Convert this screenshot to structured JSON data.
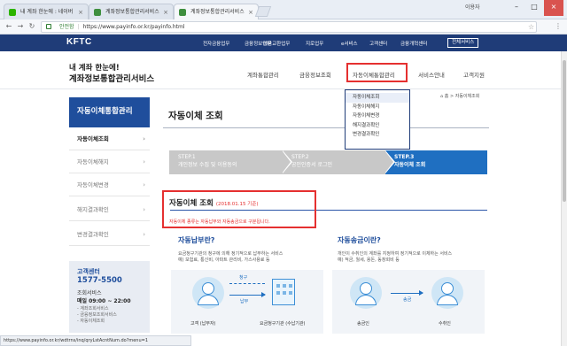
{
  "browser": {
    "tabs": [
      {
        "label": "내 계좌 한눈에 : 네이버"
      },
      {
        "label": "계좌정보통합관리서비스"
      },
      {
        "label": "계좌정보통합관리서비스"
      }
    ],
    "user": "이용자",
    "secure_label": "안전함",
    "url": "https://www.payinfo.or.kr/payinfo.html",
    "status_url": "https://www.payinfo.or.kr/wdtrns/inq/qryLstAcntNum.do?menu=1"
  },
  "gnb": {
    "logo": "KFTC",
    "items": [
      "전자금융업무",
      "금융정보업무",
      "어음교환업무",
      "지로업무",
      "e서비스",
      "고객센터",
      "금융개혁센터"
    ],
    "all_services": "전체서비스"
  },
  "header": {
    "brand_top": "내 계좌 한눈에!",
    "brand_main": "계좌정보통합관리서비스",
    "nav": [
      "계좌통합관리",
      "금융정보조회",
      "자동이체통합관리",
      "서비스안내",
      "고객지원"
    ]
  },
  "dropdown": {
    "items": [
      "자동이체조회",
      "자동이체해지",
      "자동이체변경",
      "해지결과확인",
      "변경결과확인"
    ]
  },
  "sidebar": {
    "title": "자동이체통합관리",
    "items": [
      "자동이체조회",
      "자동이체해지",
      "자동이체변경",
      "해지결과확인",
      "변경결과확인"
    ],
    "help": {
      "title": "고객센터",
      "phone": "1577-5500",
      "service": "조회서비스",
      "hours": "매일 09:00 ~ 22:00",
      "lines": [
        "- 계좌조회서비스",
        "- 금융정보조회서비스",
        "- 자동이체조회"
      ]
    }
  },
  "main": {
    "breadcrumb": "홈 > 자동이체조회",
    "title": "자동이체 조회",
    "steps": [
      {
        "num": "STEP.1",
        "label": "개인정보 수집 및 이용동의"
      },
      {
        "num": "STEP.2",
        "label": "공인인증서 로그인"
      },
      {
        "num": "STEP.3",
        "label": "자동이체 조회"
      }
    ],
    "notice": {
      "title": "자동이체 조회",
      "date": "(2018.01.15 기준)",
      "desc": "자동이체 종류는 자동납부와 자동송금으로 구분됩니다."
    },
    "payment": {
      "heading": "자동납부란?",
      "desc": "요금청구기관의 청구에 의해 정기적으로 납부하는 서비스",
      "example": "예) 보험료, 통신비, 아파트 관리비, 가스사용료 등",
      "labels": {
        "charge": "청구",
        "pay": "납부",
        "customer": "고객 (납부자)",
        "agency": "요금청구기관 (수납기관)"
      }
    },
    "transfer": {
      "heading": "자동송금이란?",
      "desc": "개인이 수취인의 계좌를 지정하여 정기적으로 이체하는 서비스",
      "example": "예) 적금, 월세, 용돈, 동창회비 등",
      "labels": {
        "send": "송금",
        "sender": "송금인",
        "receiver": "수취인"
      }
    }
  }
}
